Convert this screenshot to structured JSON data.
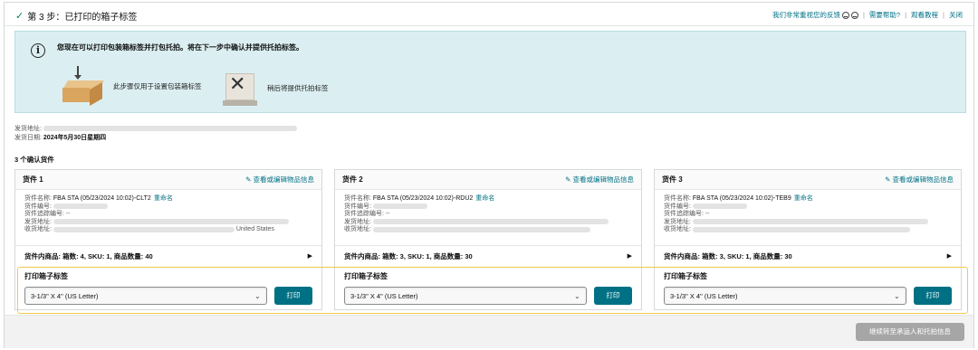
{
  "header": {
    "title": "第 3 步：已打印的箱子标签",
    "links": {
      "feedback": "我们非常重视您的反馈",
      "help": "需要帮助?",
      "tutorial": "观看教程",
      "close": "关闭"
    }
  },
  "info": {
    "message": "您现在可以打印包装箱标签并打包托拍。将在下一步中确认并提供托拍标签。",
    "step1": "此步骤仅用于设置包装箱标签",
    "step2": "稍后将提供托拍标签"
  },
  "shipping": {
    "address_label": "发货地址:",
    "date_label": "发货日期:",
    "date_value": "2024年5月30日星期四"
  },
  "confirm_count": "3 个确认货件",
  "shipments": [
    {
      "title": "货件 1",
      "edit": "查看或编辑物品信息",
      "name_label": "货件名称:",
      "name_value": "FBA STA (05/23/2024 10:02)-CLT2",
      "rename": "重命名",
      "number_label": "货件编号:",
      "tracking_label": "货件追踪编号:",
      "tracking_value": "--",
      "from_label": "发货地址:",
      "to_label": "收货地址:",
      "to_value_tail": "United States",
      "summary": "货件内商品: 箱数: 4, SKU: 1, 商品数量: 40",
      "print_label": "打印箱子标签",
      "paper": "3-1/3\" X 4\" (US Letter)",
      "print_button": "打印"
    },
    {
      "title": "货件 2",
      "edit": "查看或编辑物品信息",
      "name_label": "货件名称:",
      "name_value": "FBA STA (05/23/2024 10:02)-RDU2",
      "rename": "重命名",
      "number_label": "货件编号:",
      "tracking_label": "货件追踪编号:",
      "tracking_value": "--",
      "from_label": "发货地址:",
      "to_label": "收货地址:",
      "to_value_tail": "",
      "summary": "货件内商品: 箱数: 3, SKU: 1, 商品数量: 30",
      "print_label": "打印箱子标签",
      "paper": "3-1/3\" X 4\" (US Letter)",
      "print_button": "打印"
    },
    {
      "title": "货件 3",
      "edit": "查看或编辑物品信息",
      "name_label": "货件名称:",
      "name_value": "FBA STA (05/23/2024 10:02)-TEB9",
      "rename": "重命名",
      "number_label": "货件编号:",
      "tracking_label": "货件追踪编号:",
      "tracking_value": "--",
      "from_label": "发货地址:",
      "to_label": "收货地址:",
      "to_value_tail": "",
      "summary": "货件内商品: 箱数: 3, SKU: 1, 商品数量: 30",
      "print_label": "打印箱子标签",
      "paper": "3-1/3\" X 4\" (US Letter)",
      "print_button": "打印"
    }
  ],
  "footer": {
    "continue": "继续转至承运人和托拍信息"
  }
}
